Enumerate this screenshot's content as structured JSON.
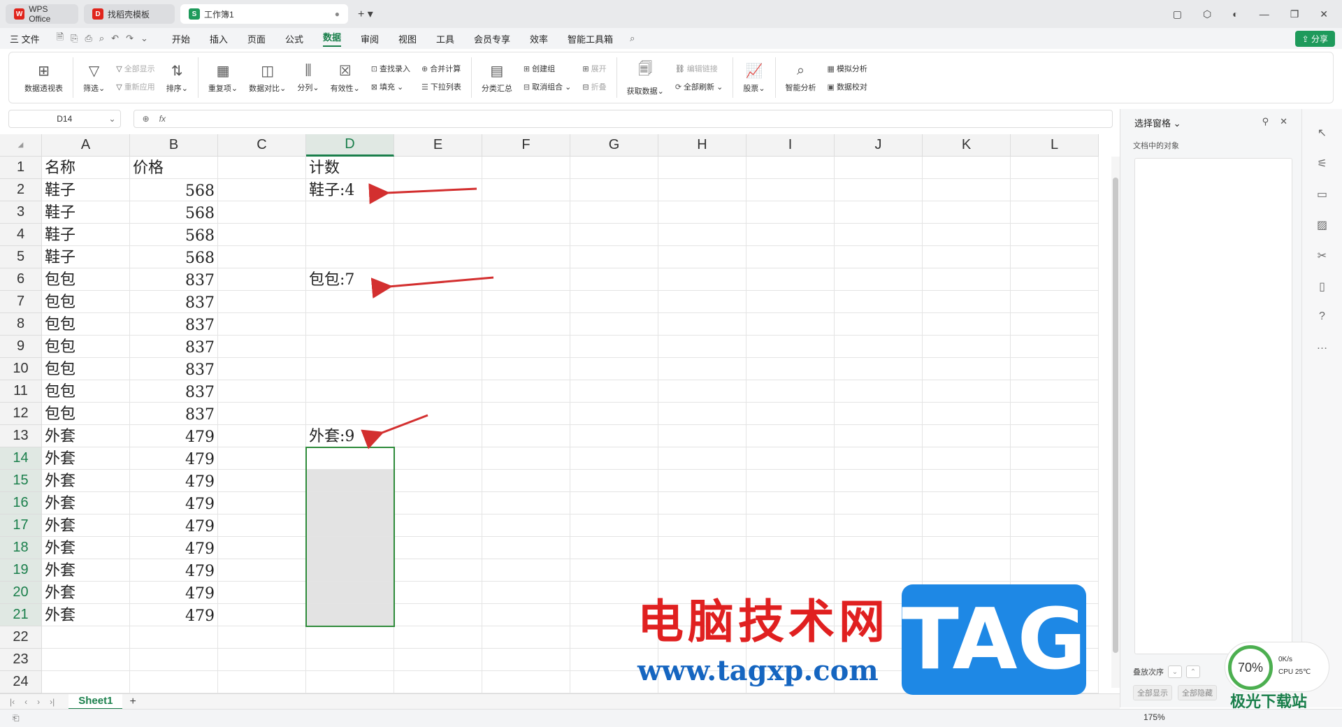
{
  "tabs": [
    {
      "label": "WPS Office",
      "color": "#e0241c",
      "logo": "W"
    },
    {
      "label": "找稻壳模板",
      "color": "#e0241c",
      "logo": "D"
    },
    {
      "label": "工作簿1",
      "color": "#1e9a5b",
      "logo": "S"
    }
  ],
  "menu": {
    "file": "三 文件",
    "items": [
      "开始",
      "插入",
      "页面",
      "公式",
      "数据",
      "审阅",
      "视图",
      "工具",
      "会员专享",
      "效率",
      "智能工具箱"
    ],
    "active_index": 4,
    "share": "分享"
  },
  "ribbon": {
    "pivot": "数据透视表",
    "filter": "筛选",
    "show_all": "全部显示",
    "reapply": "重新应用",
    "sort": "排序",
    "duplicates": "重复项",
    "compare": "数据对比",
    "split": "分列",
    "validity": "有效性",
    "lookup": "查找录入",
    "fill": "填充",
    "consolidate": "合并计算",
    "dropdown": "下拉列表",
    "subtotal": "分类汇总",
    "group": "创建组",
    "ungroup": "取消组合",
    "expand": "展开",
    "collapse": "折叠",
    "get_data": "获取数据",
    "edit_links": "编辑链接",
    "refresh_all": "全部刷新",
    "stocks": "股票",
    "smart_analysis": "智能分析",
    "simulate": "模拟分析",
    "verify": "数据校对"
  },
  "formula_bar": {
    "name_box": "D14",
    "fx": "fx"
  },
  "sheet": {
    "columns": [
      "A",
      "B",
      "C",
      "D",
      "E",
      "F",
      "G",
      "H",
      "I",
      "J",
      "K",
      "L"
    ],
    "selected_column": "D",
    "rows": [
      {
        "n": "1",
        "a": "名称",
        "b": "价格",
        "d": "计数"
      },
      {
        "n": "2",
        "a": "鞋子",
        "b": "568",
        "d": "鞋子:4"
      },
      {
        "n": "3",
        "a": "鞋子",
        "b": "568",
        "d": ""
      },
      {
        "n": "4",
        "a": "鞋子",
        "b": "568",
        "d": ""
      },
      {
        "n": "5",
        "a": "鞋子",
        "b": "568",
        "d": ""
      },
      {
        "n": "6",
        "a": "包包",
        "b": "837",
        "d": "包包:7"
      },
      {
        "n": "7",
        "a": "包包",
        "b": "837",
        "d": ""
      },
      {
        "n": "8",
        "a": "包包",
        "b": "837",
        "d": ""
      },
      {
        "n": "9",
        "a": "包包",
        "b": "837",
        "d": ""
      },
      {
        "n": "10",
        "a": "包包",
        "b": "837",
        "d": ""
      },
      {
        "n": "11",
        "a": "包包",
        "b": "837",
        "d": ""
      },
      {
        "n": "12",
        "a": "包包",
        "b": "837",
        "d": ""
      },
      {
        "n": "13",
        "a": "外套",
        "b": "479",
        "d": "外套:9"
      },
      {
        "n": "14",
        "a": "外套",
        "b": "479",
        "d": ""
      },
      {
        "n": "15",
        "a": "外套",
        "b": "479",
        "d": ""
      },
      {
        "n": "16",
        "a": "外套",
        "b": "479",
        "d": ""
      },
      {
        "n": "17",
        "a": "外套",
        "b": "479",
        "d": ""
      },
      {
        "n": "18",
        "a": "外套",
        "b": "479",
        "d": ""
      },
      {
        "n": "19",
        "a": "外套",
        "b": "479",
        "d": ""
      },
      {
        "n": "20",
        "a": "外套",
        "b": "479",
        "d": ""
      },
      {
        "n": "21",
        "a": "外套",
        "b": "479",
        "d": ""
      },
      {
        "n": "22",
        "a": "",
        "b": "",
        "d": ""
      },
      {
        "n": "23",
        "a": "",
        "b": "",
        "d": ""
      },
      {
        "n": "24",
        "a": "",
        "b": "",
        "d": ""
      }
    ],
    "selected_rows": [
      "14",
      "15",
      "16",
      "17",
      "18",
      "19",
      "20",
      "21"
    ],
    "sheet_tab": "Sheet1"
  },
  "panel": {
    "title": "选择窗格",
    "subtitle": "文档中的对象",
    "order_label": "叠放次序",
    "show_all": "全部显示",
    "hide_all": "全部隐藏"
  },
  "status": {
    "zoom": "175%"
  },
  "watermark": {
    "cn": "电脑技术网",
    "url": "www.tagxp.com",
    "tag": "TAG",
    "xz": "极光下载站"
  },
  "cpu_widget": {
    "percent": "70%",
    "speed": "0K/s",
    "cpu": "CPU 25℃"
  },
  "colors": {
    "accent": "#1a7f4b",
    "arrow": "#d32f2f"
  }
}
